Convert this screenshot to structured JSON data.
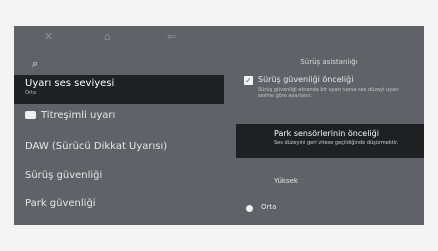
{
  "top_icons": [
    "close-icon",
    "home-icon",
    "back-icon"
  ],
  "search": {
    "icon": "search-icon"
  },
  "left_menu": {
    "selected": {
      "label": "Uyarı ses seviyesi",
      "sub": "Orta"
    },
    "items": [
      {
        "label": "Titreşimli uyarı"
      },
      {
        "label": "DAW (Sürücü Dikkat Uyarısı)"
      },
      {
        "label": "Sürüş güvenliği"
      },
      {
        "label": "Park güvenliği"
      }
    ]
  },
  "right_panel": {
    "title": "Sürüş asistanlığı",
    "check_item": {
      "title": "Sürüş güvenliği önceliği",
      "desc": "Sürüş güvenliği ekranda bir uyarı varsa ses düzeyi uyarı sesine göre ayarlanır.",
      "checked": true
    },
    "selected_item": {
      "title": "Park sensörlerinin önceliği",
      "desc": "Ses düzeyini geri vitese geçildiğinde düşürmektir."
    },
    "options": [
      {
        "label": "Yüksek",
        "selected": false
      },
      {
        "label": "Orta",
        "selected": true
      }
    ]
  }
}
